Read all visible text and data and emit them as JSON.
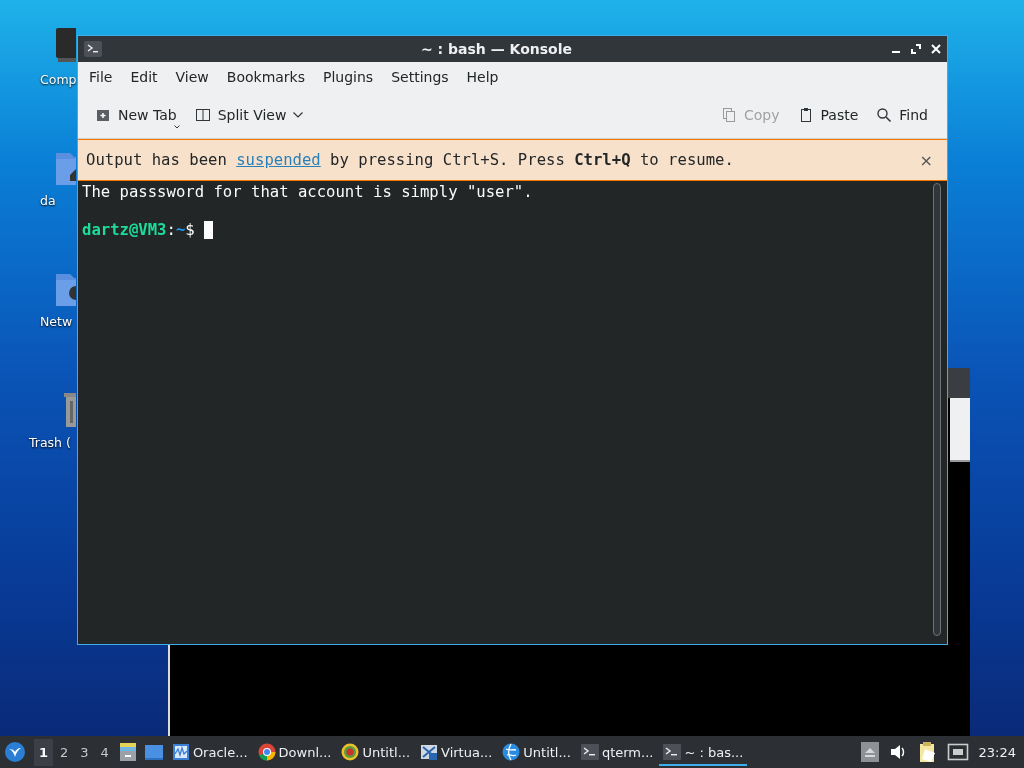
{
  "desktop_icons": [
    {
      "label": "Comp",
      "kind": "computer"
    },
    {
      "label": "da",
      "kind": "home"
    },
    {
      "label": "Netw",
      "kind": "network"
    },
    {
      "label": "Trash (",
      "kind": "trash"
    }
  ],
  "window": {
    "title": "~ : bash — Konsole",
    "menu": [
      "File",
      "Edit",
      "View",
      "Bookmarks",
      "Plugins",
      "Settings",
      "Help"
    ],
    "toolbar": [
      {
        "label": "New Tab",
        "kind": "new-tab",
        "disabled": false
      },
      {
        "label": "Split View",
        "kind": "split",
        "disabled": false
      },
      {
        "label": "Copy",
        "kind": "copy",
        "disabled": true
      },
      {
        "label": "Paste",
        "kind": "paste",
        "disabled": false
      },
      {
        "label": "Find",
        "kind": "find",
        "disabled": false
      }
    ],
    "notification": {
      "parts": [
        {
          "text": "Output has been ",
          "kind": "text"
        },
        {
          "text": "suspended",
          "kind": "link"
        },
        {
          "text": " by pressing Ctrl+S. Press **Ctrl+Q** to resume.",
          "kind": "text"
        }
      ],
      "close": "×"
    },
    "terminal": {
      "output": "The passsword for that account is simply \"user\".",
      "prompt": {
        "user_host": "dartz@VM3",
        "separator": ":",
        "path": "~",
        "symbol": "$"
      }
    }
  },
  "taskbar": {
    "workspaces": [
      {
        "label": "1",
        "selected": true
      },
      {
        "label": "2",
        "selected": false
      },
      {
        "label": "3",
        "selected": false
      },
      {
        "label": "4",
        "selected": false
      }
    ],
    "tasks": [
      {
        "label": "Oracle...",
        "kind": "monitor",
        "selected": false
      },
      {
        "label": "Downl...",
        "kind": "chrome",
        "selected": false
      },
      {
        "label": "Untitl...",
        "kind": "target",
        "selected": false
      },
      {
        "label": "Virtua...",
        "kind": "vbox",
        "selected": false
      },
      {
        "label": "Untitl...",
        "kind": "globe",
        "selected": false
      },
      {
        "label": "qterm...",
        "kind": "terminal",
        "selected": false
      },
      {
        "label": "~ : bas...",
        "kind": "terminal",
        "selected": true
      }
    ],
    "clock": "23:24"
  }
}
